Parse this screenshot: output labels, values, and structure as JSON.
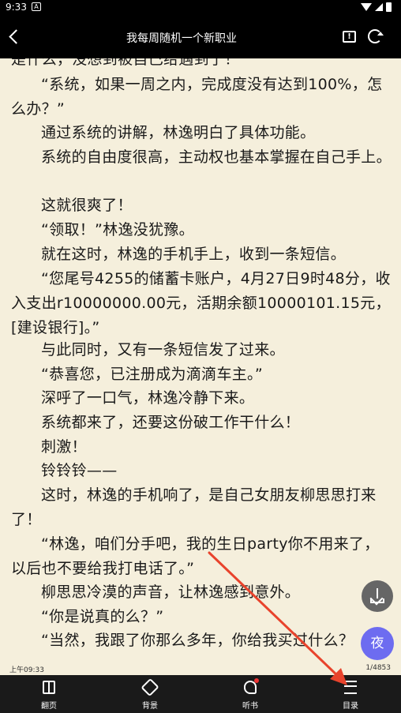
{
  "status_bar": {
    "time": "9:33",
    "notification": "A"
  },
  "header": {
    "title": "我每周随机一个新职业"
  },
  "content": {
    "paragraphs": [
      {
        "text": "是什么，没想到被自己给遇到了！",
        "indent": false
      },
      {
        "text": "“系统，如果一周之内，完成度没有达到100%，怎么办？”",
        "indent": true
      },
      {
        "text": "通过系统的讲解，林逸明白了具体功能。",
        "indent": true
      },
      {
        "text": "系统的自由度很高，主动权也基本掌握在自己手上。",
        "indent": true
      },
      {
        "text": "这就很爽了！",
        "indent": true
      },
      {
        "text": "“领取！”林逸没犹豫。",
        "indent": true
      },
      {
        "text": "就在这时，林逸的手机手上，收到一条短信。",
        "indent": true
      },
      {
        "text": "“您尾号4255的储蓄卡账户，4月27日9时48分，收入支出r10000000.00元，活期余额10000101.15元，[建设银行]。”",
        "indent": true
      },
      {
        "text": "与此同时，又有一条短信发了过来。",
        "indent": true
      },
      {
        "text": "“恭喜您，已注册成为滴滴车主。”",
        "indent": true
      },
      {
        "text": "深呼了一口气，林逸冷静下来。",
        "indent": true
      },
      {
        "text": "系统都来了，还要这份破工作干什么！",
        "indent": true
      },
      {
        "text": "刺激！",
        "indent": true
      },
      {
        "text": "铃铃铃——",
        "indent": true
      },
      {
        "text": "这时，林逸的手机响了，是自己女朋友柳思思打来了！",
        "indent": true
      },
      {
        "text": "“林逸，咱们分手吧，我的生日party你不用来了，以后也不要给我打电话了。”",
        "indent": true
      },
      {
        "text": "柳思思冷漠的声音，让林逸感到意外。",
        "indent": true
      },
      {
        "text": "“你是说真的么？”",
        "indent": true
      },
      {
        "text": "“当然，我跟了你那么多年，你给我买过什么？",
        "indent": true
      }
    ]
  },
  "footer": {
    "clock": "上午09:33",
    "page": "1/4853"
  },
  "fab": {
    "night_label": "夜"
  },
  "bottom_nav": {
    "items": [
      {
        "label": "翻页",
        "icon": "page-turn-icon"
      },
      {
        "label": "背景",
        "icon": "background-icon"
      },
      {
        "label": "听书",
        "icon": "listen-icon"
      },
      {
        "label": "目录",
        "icon": "toc-icon"
      }
    ]
  },
  "colors": {
    "page_bg": "#f5efdc",
    "bar_bg": "#000000",
    "night_fab": "#6d6cf0",
    "annotation_arrow": "#e8432c"
  }
}
